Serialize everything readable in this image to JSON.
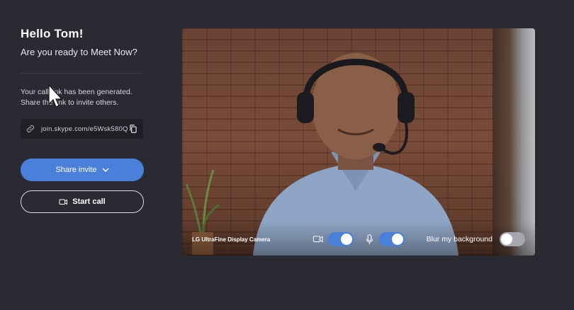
{
  "greeting": "Hello Tom!",
  "subtitle": "Are you ready to Meet Now?",
  "info_text": "Your call link has been generated. Share the link to invite others.",
  "link": {
    "url": "join.skype.com/e5Wsk580Q",
    "link_icon": "link-icon",
    "copy_icon": "copy-icon"
  },
  "buttons": {
    "share_invite": "Share invite",
    "start_call": "Start call"
  },
  "video": {
    "camera_name": "LG UltraFine Display Camera",
    "camera_toggle": true,
    "mic_toggle": true,
    "blur_label": "Blur my background",
    "blur_toggle": false
  },
  "colors": {
    "background": "#2a2a33",
    "accent": "#4a80d9"
  }
}
